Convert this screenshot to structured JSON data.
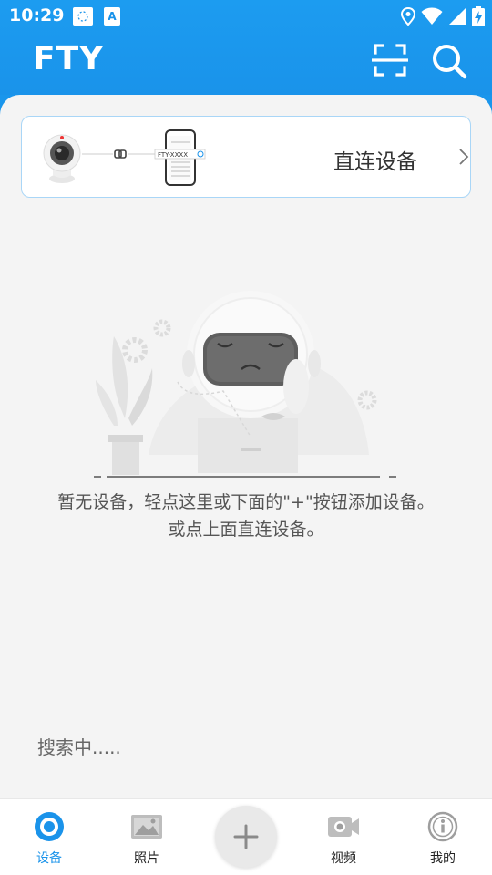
{
  "status_bar": {
    "time": "10:29",
    "notif_badge": "A"
  },
  "header": {
    "title": "FTY"
  },
  "direct_connect": {
    "label": "直连设备",
    "phone_caption": "FTY-XXXX"
  },
  "empty_state": {
    "line1": "暂无设备，轻点这里或下面的\"+\"按钮添加设备。",
    "line2": "或点上面直连设备。"
  },
  "status": {
    "searching": "搜索中....."
  },
  "tabbar": {
    "tabs": [
      {
        "label": "设备",
        "icon": "camera-icon",
        "active": true
      },
      {
        "label": "照片",
        "icon": "photo-icon",
        "active": false
      },
      {
        "label": "",
        "icon": "plus-icon",
        "active": false
      },
      {
        "label": "视频",
        "icon": "video-icon",
        "active": false
      },
      {
        "label": "我的",
        "icon": "info-icon",
        "active": false
      }
    ]
  },
  "colors": {
    "accent": "#1a93ea",
    "background": "#f4f4f4",
    "card_border": "#a9d6f7"
  }
}
